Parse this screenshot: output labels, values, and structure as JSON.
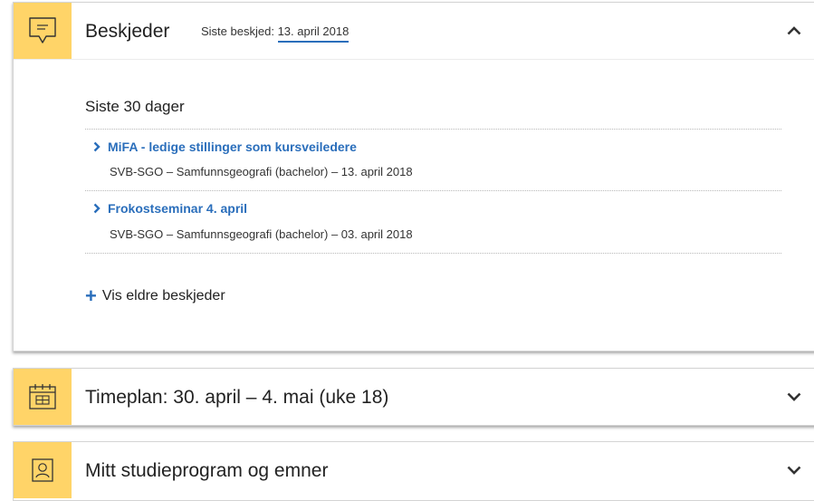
{
  "messages_panel": {
    "title": "Beskjeder",
    "last_label": "Siste beskjed:",
    "last_date": "13. april 2018",
    "section_title": "Siste 30 dager",
    "items": [
      {
        "title": "MiFA - ledige stillinger som kursveiledere",
        "meta": "SVB-SGO – Samfunnsgeografi (bachelor) – 13. april 2018"
      },
      {
        "title": "Frokostseminar 4. april",
        "meta": "SVB-SGO – Samfunnsgeografi (bachelor) – 03. april 2018"
      }
    ],
    "older_label": "Vis eldre beskjeder",
    "expanded_icon": "chevron-up-icon"
  },
  "schedule_panel": {
    "title": "Timeplan: 30. april – 4. mai (uke 18)",
    "icon": "calendar-icon"
  },
  "program_panel": {
    "title": "Mitt studieprogram og emner",
    "icon": "person-icon"
  },
  "colors": {
    "icon_bg": "#ffd468",
    "link": "#2a6ebb"
  }
}
